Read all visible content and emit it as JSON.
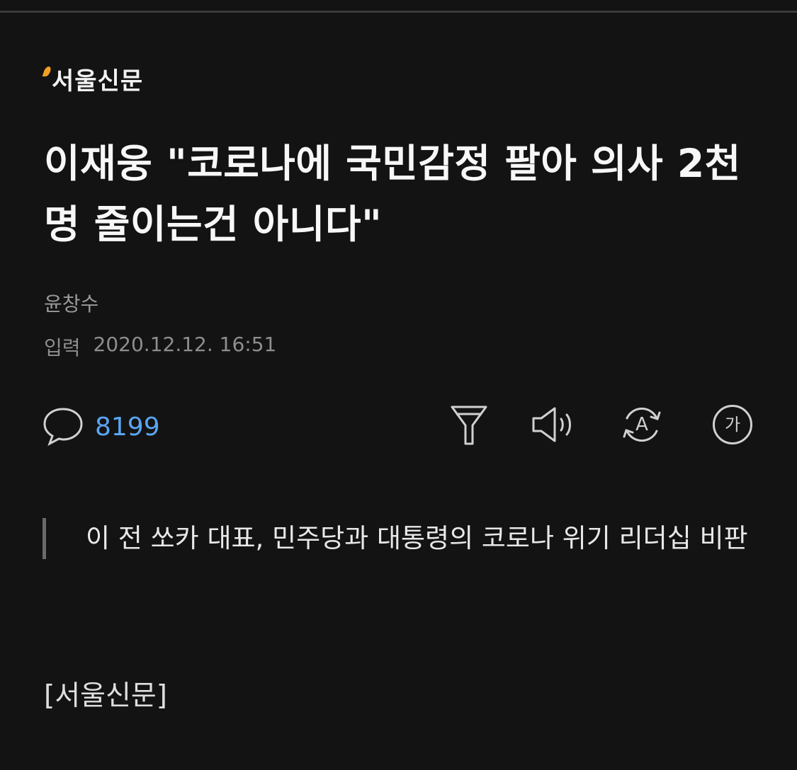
{
  "publisher": {
    "logo_text": "서울신문",
    "logo_accent_color": "#f2a024"
  },
  "article": {
    "headline": "이재웅 \"코로나에 국민감정 팔아 의사 2천명 줄이는건 아니다\"",
    "author": "윤창수",
    "date_label": "입력",
    "date_value": "2020.12.12. 16:51",
    "summary": "이 전 쏘카 대표, 민주당과 대통령의 코로나 위기 리더십 비판",
    "source_tag": "[서울신문]"
  },
  "toolbar": {
    "comment_count": "8199",
    "comment_icon": "speech-bubble-icon",
    "filter_icon": "funnel-icon",
    "audio_icon": "speaker-icon",
    "translate_icon": "auto-translate-icon",
    "font_size_icon": "font-size-icon",
    "font_size_glyph": "가",
    "translate_glyph": "A",
    "accent_color": "#5aa6f2"
  }
}
